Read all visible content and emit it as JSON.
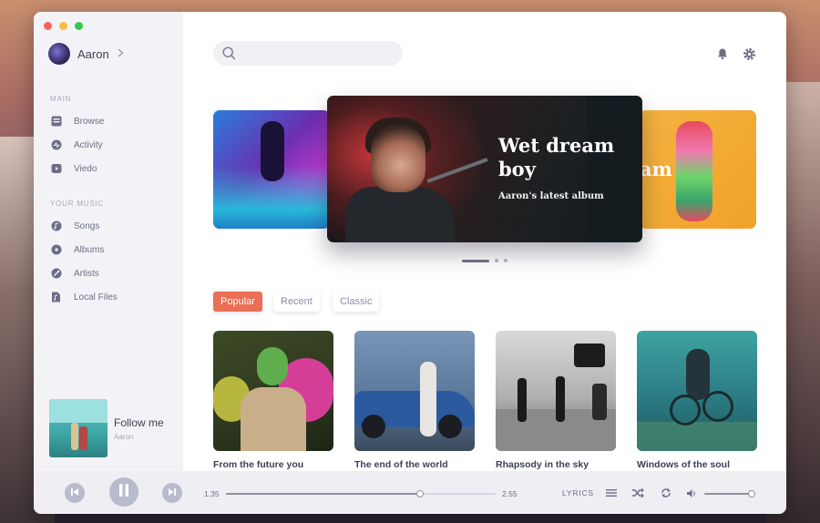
{
  "sidebar": {
    "user": {
      "name": "Aaron"
    },
    "sections": [
      {
        "title": "MAIN",
        "items": [
          {
            "label": "Browse",
            "icon": "browse-icon"
          },
          {
            "label": "Activity",
            "icon": "activity-icon"
          },
          {
            "label": "Viedo",
            "icon": "video-icon"
          }
        ]
      },
      {
        "title": "YOUR MUSIC",
        "items": [
          {
            "label": "Songs",
            "icon": "songs-icon"
          },
          {
            "label": "Albums",
            "icon": "albums-icon"
          },
          {
            "label": "Artists",
            "icon": "artists-icon"
          },
          {
            "label": "Local Files",
            "icon": "local-files-icon"
          }
        ]
      }
    ],
    "now_playing": {
      "title": "Follow me",
      "artist": "Aaron"
    }
  },
  "search": {
    "value": "",
    "placeholder": ""
  },
  "carousel": {
    "featured": {
      "title": "Wet dream boy",
      "subtitle": "Aaron's latest album"
    },
    "right_card_text": "am",
    "indicator": {
      "count": 3,
      "active": 0
    }
  },
  "tabs": [
    {
      "label": "Popular",
      "active": true
    },
    {
      "label": "Recent",
      "active": false
    },
    {
      "label": "Classic",
      "active": false
    }
  ],
  "albums": [
    {
      "title": "From the future you"
    },
    {
      "title": "The end of the world"
    },
    {
      "title": "Rhapsody in the sky"
    },
    {
      "title": "Windows of the soul"
    }
  ],
  "player": {
    "current_time": "1.35",
    "total_time": "2.55",
    "progress": 0.72,
    "lyrics_label": "LYRICS",
    "volume": 1.0
  },
  "colors": {
    "accent": "#ea6f55",
    "text_primary": "#3d3f55",
    "text_secondary": "#6c6e86",
    "sidebar_bg": "#f3f3f7"
  }
}
